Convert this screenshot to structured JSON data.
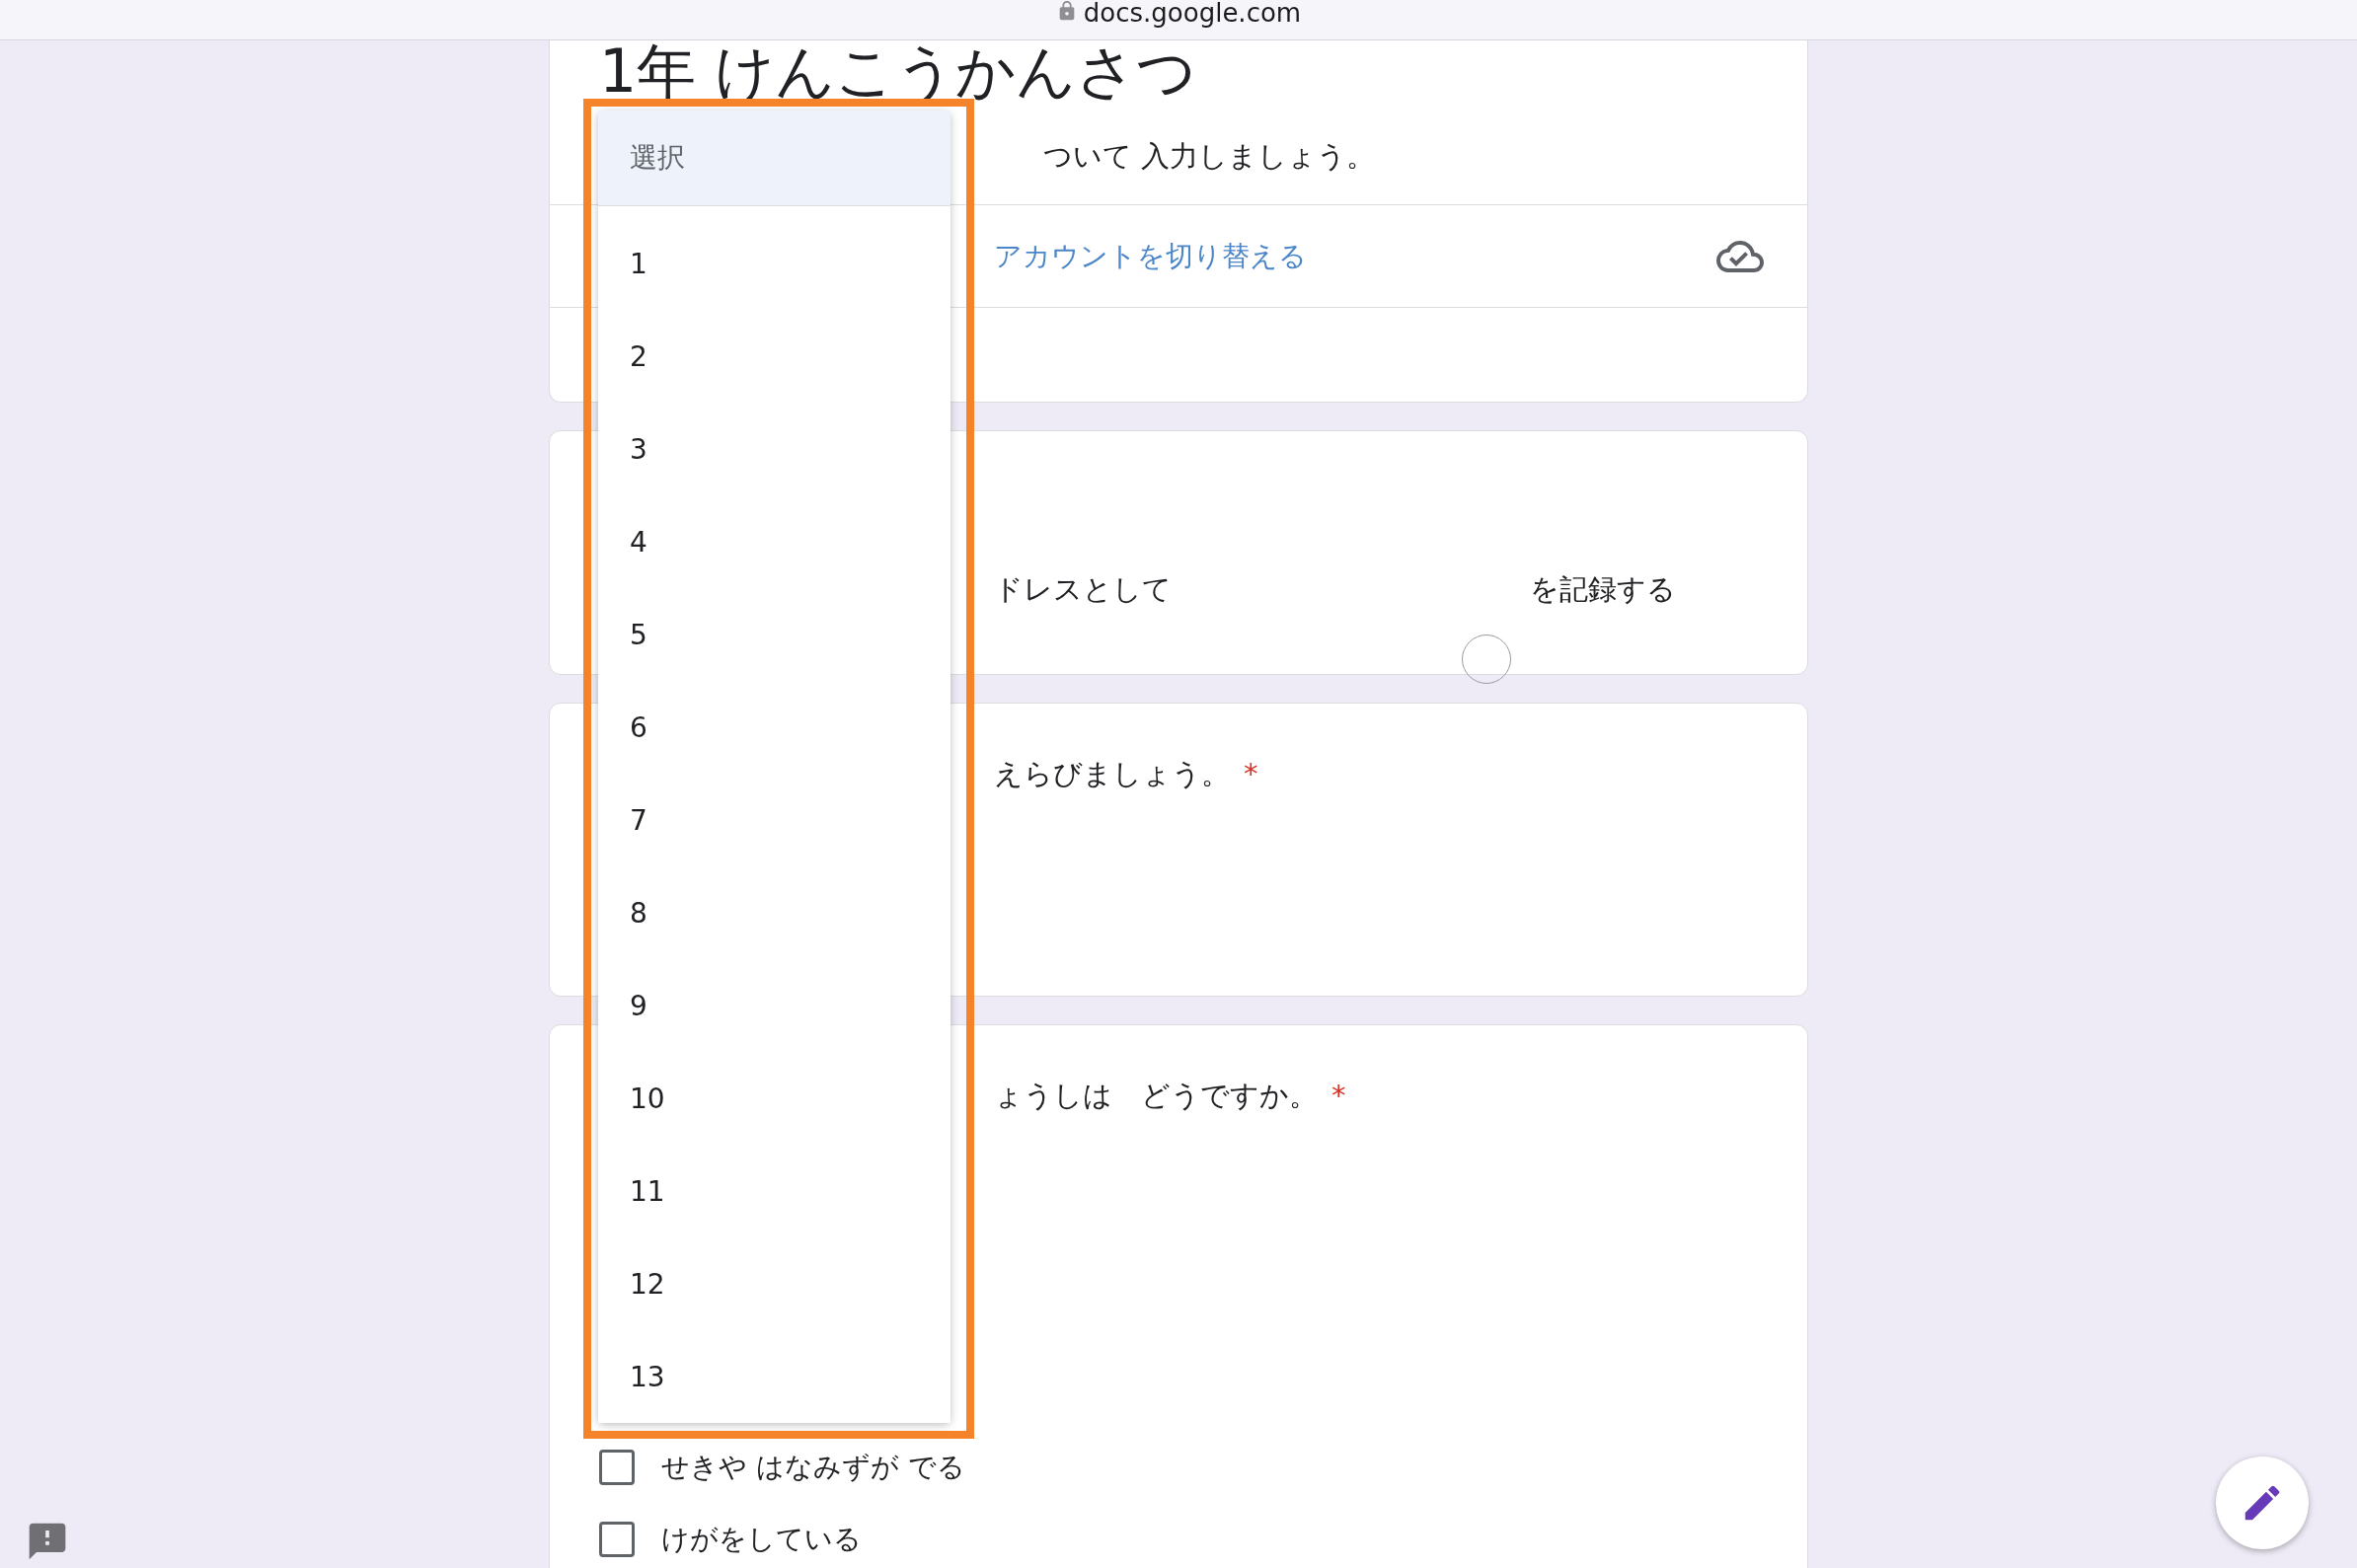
{
  "browser": {
    "url": "docs.google.com"
  },
  "header_card": {
    "title": "1年 けんこうかんさつ",
    "description": "ついて 入力しましょう。",
    "switch_account_link": "アカウントを切り替える"
  },
  "questions": [
    {
      "kind": "email",
      "text_left": "ドレスとして",
      "text_right": "を記録する"
    },
    {
      "kind": "question",
      "text": "えらびましょう。",
      "required": true,
      "required_mark": "*"
    },
    {
      "kind": "question",
      "text": "ょうしは　どうですか。",
      "required": true,
      "required_mark": "*",
      "options": [
        {
          "label": "せきや はなみずが でる",
          "checked": false
        },
        {
          "label": "けがをしている",
          "checked": false
        }
      ]
    }
  ],
  "dropdown": {
    "items": [
      {
        "label": "選択",
        "selected": true
      },
      {
        "label": "1",
        "selected": false
      },
      {
        "label": "2",
        "selected": false
      },
      {
        "label": "3",
        "selected": false
      },
      {
        "label": "4",
        "selected": false
      },
      {
        "label": "5",
        "selected": false
      },
      {
        "label": "6",
        "selected": false
      },
      {
        "label": "7",
        "selected": false
      },
      {
        "label": "8",
        "selected": false
      },
      {
        "label": "9",
        "selected": false
      },
      {
        "label": "10",
        "selected": false
      },
      {
        "label": "11",
        "selected": false
      },
      {
        "label": "12",
        "selected": false
      },
      {
        "label": "13",
        "selected": false
      }
    ]
  }
}
